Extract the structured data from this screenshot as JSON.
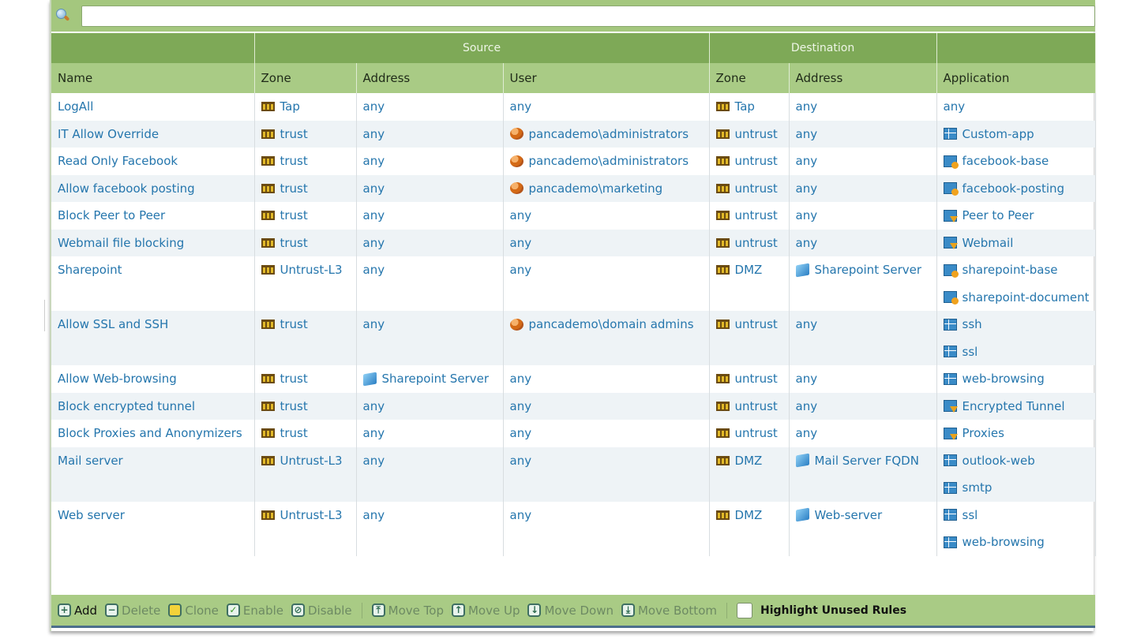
{
  "search": {
    "placeholder": "",
    "value": ""
  },
  "headers": {
    "group_source": "Source",
    "group_destination": "Destination",
    "name": "Name",
    "src_zone": "Zone",
    "src_address": "Address",
    "user": "User",
    "dst_zone": "Zone",
    "dst_address": "Address",
    "application": "Application"
  },
  "rules": [
    {
      "name": "LogAll",
      "src_zone": "Tap",
      "src_address": [
        {
          "text": "any"
        }
      ],
      "user": [
        {
          "text": "any"
        }
      ],
      "dst_zone": "Tap",
      "dst_address": [
        {
          "text": "any"
        }
      ],
      "application": [
        {
          "text": "any"
        }
      ]
    },
    {
      "name": "IT Allow Override",
      "src_zone": "trust",
      "src_address": [
        {
          "text": "any"
        }
      ],
      "user": [
        {
          "text": "pancademo\\administrators",
          "icon": "user-group-icon"
        }
      ],
      "dst_zone": "untrust",
      "dst_address": [
        {
          "text": "any"
        }
      ],
      "application": [
        {
          "text": "Custom-app",
          "icon": "app-icon"
        }
      ]
    },
    {
      "name": "Read Only Facebook",
      "src_zone": "trust",
      "src_address": [
        {
          "text": "any"
        }
      ],
      "user": [
        {
          "text": "pancademo\\administrators",
          "icon": "user-group-icon"
        }
      ],
      "dst_zone": "untrust",
      "dst_address": [
        {
          "text": "any"
        }
      ],
      "application": [
        {
          "text": "facebook-base",
          "icon": "app-group-icon"
        }
      ]
    },
    {
      "name": "Allow facebook posting",
      "src_zone": "trust",
      "src_address": [
        {
          "text": "any"
        }
      ],
      "user": [
        {
          "text": "pancademo\\marketing",
          "icon": "user-group-icon"
        }
      ],
      "dst_zone": "untrust",
      "dst_address": [
        {
          "text": "any"
        }
      ],
      "application": [
        {
          "text": "facebook-posting",
          "icon": "app-group-icon"
        }
      ]
    },
    {
      "name": "Block Peer to Peer",
      "src_zone": "trust",
      "src_address": [
        {
          "text": "any"
        }
      ],
      "user": [
        {
          "text": "any"
        }
      ],
      "dst_zone": "untrust",
      "dst_address": [
        {
          "text": "any"
        }
      ],
      "application": [
        {
          "text": "Peer to Peer",
          "icon": "app-filter-icon"
        }
      ]
    },
    {
      "name": "Webmail file blocking",
      "src_zone": "trust",
      "src_address": [
        {
          "text": "any"
        }
      ],
      "user": [
        {
          "text": "any"
        }
      ],
      "dst_zone": "untrust",
      "dst_address": [
        {
          "text": "any"
        }
      ],
      "application": [
        {
          "text": "Webmail",
          "icon": "app-filter-icon"
        }
      ]
    },
    {
      "name": "Sharepoint",
      "src_zone": "Untrust-L3",
      "src_address": [
        {
          "text": "any"
        }
      ],
      "user": [
        {
          "text": "any"
        }
      ],
      "dst_zone": "DMZ",
      "dst_address": [
        {
          "text": "Sharepoint Server",
          "icon": "server-icon"
        }
      ],
      "application": [
        {
          "text": "sharepoint-base",
          "icon": "app-group-icon"
        },
        {
          "text": "sharepoint-document",
          "icon": "app-group-icon"
        }
      ]
    },
    {
      "name": "Allow SSL and SSH",
      "src_zone": "trust",
      "src_address": [
        {
          "text": "any"
        }
      ],
      "user": [
        {
          "text": "pancademo\\domain admins",
          "icon": "user-group-icon"
        }
      ],
      "dst_zone": "untrust",
      "dst_address": [
        {
          "text": "any"
        }
      ],
      "application": [
        {
          "text": "ssh",
          "icon": "app-icon"
        },
        {
          "text": "ssl",
          "icon": "app-icon"
        }
      ]
    },
    {
      "name": "Allow Web-browsing",
      "src_zone": "trust",
      "src_address": [
        {
          "text": "Sharepoint Server",
          "icon": "server-icon"
        }
      ],
      "user": [
        {
          "text": "any"
        }
      ],
      "dst_zone": "untrust",
      "dst_address": [
        {
          "text": "any"
        }
      ],
      "application": [
        {
          "text": "web-browsing",
          "icon": "app-icon"
        }
      ]
    },
    {
      "name": "Block encrypted tunnel",
      "src_zone": "trust",
      "src_address": [
        {
          "text": "any"
        }
      ],
      "user": [
        {
          "text": "any"
        }
      ],
      "dst_zone": "untrust",
      "dst_address": [
        {
          "text": "any"
        }
      ],
      "application": [
        {
          "text": "Encrypted Tunnel",
          "icon": "app-filter-icon"
        }
      ]
    },
    {
      "name": "Block Proxies and Anonymizers",
      "src_zone": "trust",
      "src_address": [
        {
          "text": "any"
        }
      ],
      "user": [
        {
          "text": "any"
        }
      ],
      "dst_zone": "untrust",
      "dst_address": [
        {
          "text": "any"
        }
      ],
      "application": [
        {
          "text": "Proxies",
          "icon": "app-filter-icon"
        }
      ]
    },
    {
      "name": "Mail server",
      "src_zone": "Untrust-L3",
      "src_address": [
        {
          "text": "any"
        }
      ],
      "user": [
        {
          "text": "any"
        }
      ],
      "dst_zone": "DMZ",
      "dst_address": [
        {
          "text": "Mail Server FQDN",
          "icon": "server-icon"
        }
      ],
      "application": [
        {
          "text": "outlook-web",
          "icon": "app-icon"
        },
        {
          "text": "smtp",
          "icon": "app-icon"
        }
      ]
    },
    {
      "name": "Web server",
      "src_zone": "Untrust-L3",
      "src_address": [
        {
          "text": "any"
        }
      ],
      "user": [
        {
          "text": "any"
        }
      ],
      "dst_zone": "DMZ",
      "dst_address": [
        {
          "text": "Web-server",
          "icon": "server-icon"
        }
      ],
      "application": [
        {
          "text": "ssl",
          "icon": "app-icon"
        },
        {
          "text": "web-browsing",
          "icon": "app-icon"
        }
      ]
    }
  ],
  "toolbar": {
    "add": "Add",
    "delete": "Delete",
    "clone": "Clone",
    "enable": "Enable",
    "disable": "Disable",
    "move_top": "Move Top",
    "move_up": "Move Up",
    "move_down": "Move Down",
    "move_bottom": "Move Bottom",
    "highlight_unused": "Highlight Unused Rules"
  }
}
